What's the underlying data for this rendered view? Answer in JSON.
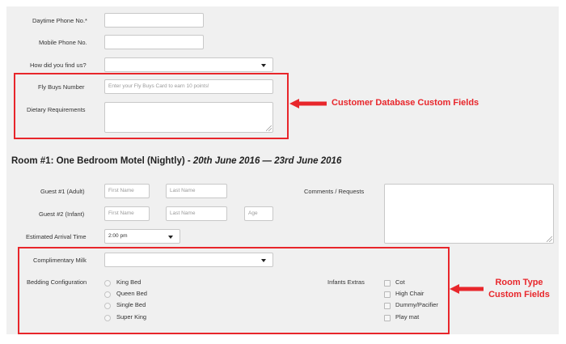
{
  "customer": {
    "daytime_phone_label": "Daytime Phone No.*",
    "mobile_phone_label": "Mobile Phone No.",
    "find_us_label": "How did you find us?",
    "fly_buys_label": "Fly Buys Number",
    "fly_buys_placeholder": "Enter your Fly Buys Card to earn 10 points!",
    "dietary_label": "Dietary Requirements"
  },
  "annotations": {
    "customer_fields": "Customer Database Custom Fields",
    "room_type_fields_line1": "Room Type",
    "room_type_fields_line2": "Custom Fields",
    "accent_color": "#e8262b"
  },
  "room": {
    "heading_prefix": "Room #1: One Bedroom Motel (Nightly) - ",
    "heading_dates": "20th June 2016 — 23rd June 2016",
    "guest1_label": "Guest #1 (Adult)",
    "guest2_label": "Guest #2 (Infant)",
    "first_name_placeholder": "First Name",
    "last_name_placeholder": "Last Name",
    "age_placeholder": "Age",
    "comments_label": "Comments / Requests",
    "arrival_label": "Estimated Arrival Time",
    "arrival_value": "2:00 pm",
    "milk_label": "Complimentary Milk",
    "bedding_label": "Bedding Configuration",
    "bedding_options": [
      "King Bed",
      "Queen Bed",
      "Single Bed",
      "Super King"
    ],
    "infants_label": "Infants Extras",
    "infant_options": [
      "Cot",
      "High Chair",
      "Dummy/Pacifier",
      "Play mat"
    ]
  }
}
